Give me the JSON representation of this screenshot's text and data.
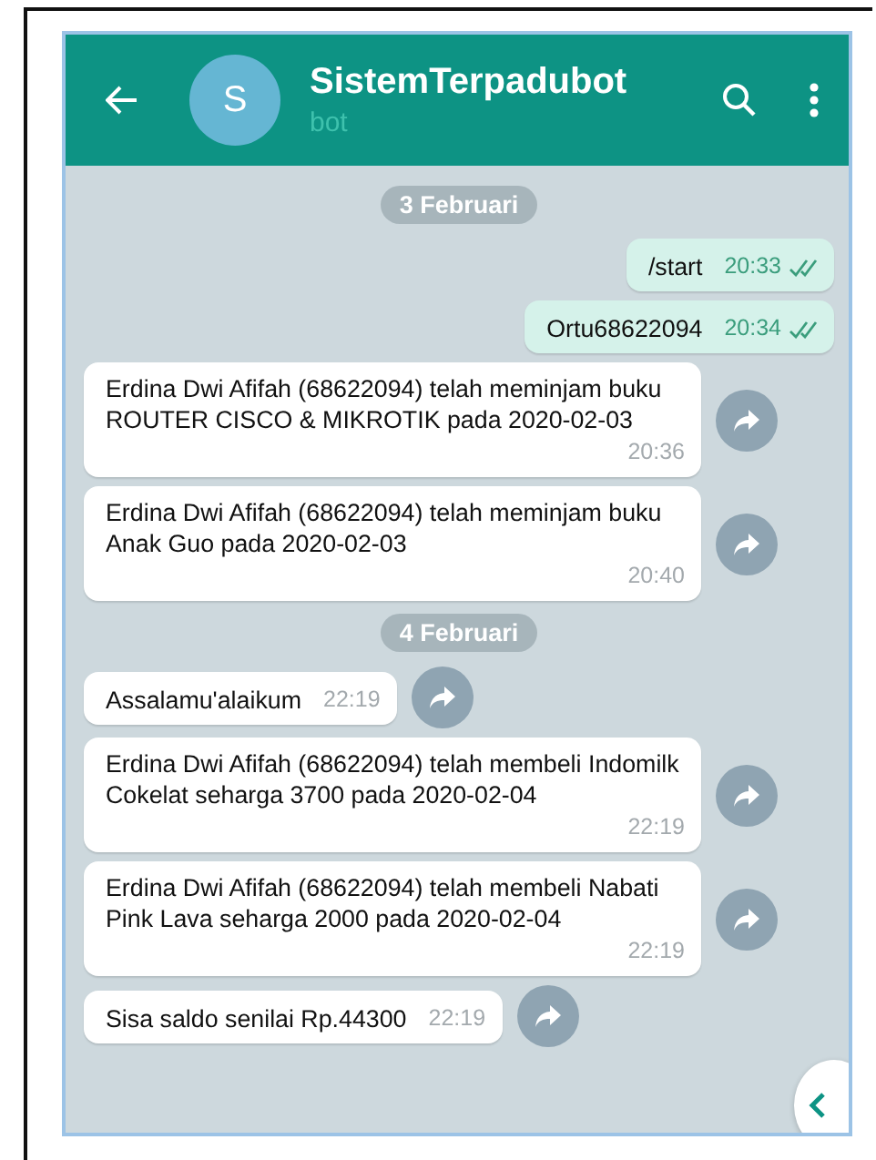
{
  "header": {
    "avatar_letter": "S",
    "title": "SistemTerpadubot",
    "subtitle": "bot"
  },
  "messages": [
    {
      "kind": "date",
      "text": "3 Februari"
    },
    {
      "kind": "out",
      "text": "/start",
      "time": "20:33",
      "read": true
    },
    {
      "kind": "out",
      "text": "Ortu68622094",
      "time": "20:34",
      "read": true
    },
    {
      "kind": "in",
      "text": "Erdina Dwi Afifah (68622094) telah meminjam buku ROUTER CISCO & MIKROTIK pada 2020-02-03",
      "time": "20:36"
    },
    {
      "kind": "in",
      "text": "Erdina Dwi Afifah (68622094) telah meminjam buku Anak Guo pada 2020-02-03",
      "time": "20:40"
    },
    {
      "kind": "date",
      "text": "4 Februari"
    },
    {
      "kind": "in",
      "text": "Assalamu'alaikum",
      "time": "22:19"
    },
    {
      "kind": "in",
      "text": "Erdina Dwi Afifah (68622094) telah membeli Indomilk Cokelat seharga 3700 pada 2020-02-04",
      "time": "22:19"
    },
    {
      "kind": "in",
      "text": "Erdina Dwi Afifah (68622094) telah membeli Nabati Pink Lava seharga 2000 pada 2020-02-04",
      "time": "22:19"
    },
    {
      "kind": "in",
      "text": "Sisa saldo senilai Rp.44300",
      "time": "22:19"
    }
  ]
}
